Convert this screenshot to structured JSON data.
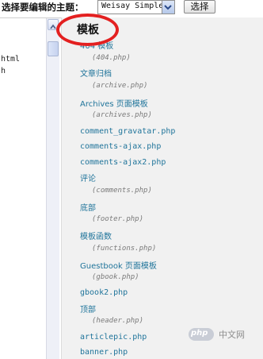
{
  "toolbar": {
    "theme_label": "选择要编辑的主题：",
    "selected_theme": "Weisay Simple",
    "select_button_label": "选择"
  },
  "editor": {
    "visible_lines": [
      "html",
      "h"
    ]
  },
  "files": {
    "heading": "模板",
    "items": [
      {
        "label": "404 模板",
        "file": "(404.php)"
      },
      {
        "label": "文章归档",
        "file": "(archive.php)"
      },
      {
        "label": "Archives 页面模板",
        "file": "(archives.php)"
      },
      {
        "label": "comment_gravatar.php"
      },
      {
        "label": "comments-ajax.php"
      },
      {
        "label": "comments-ajax2.php"
      },
      {
        "label": "评论",
        "file": "(comments.php)"
      },
      {
        "label": "底部",
        "file": "(footer.php)"
      },
      {
        "label": "模板函数",
        "file": "(functions.php)"
      },
      {
        "label": "Guestbook 页面模板",
        "file": "(gbook.php)"
      },
      {
        "label": "gbook2.php"
      },
      {
        "label": "顶部",
        "file": "(header.php)"
      },
      {
        "label": "articlepic.php"
      },
      {
        "label": "banner.php"
      }
    ]
  },
  "annotation": {
    "highlight_color": "#e32020"
  },
  "watermark": {
    "logo_text": "php",
    "site_text": "中文网"
  },
  "colors": {
    "link": "#21759b",
    "filename": "#7a7a7a",
    "panel_bg": "#f1f1f1"
  }
}
